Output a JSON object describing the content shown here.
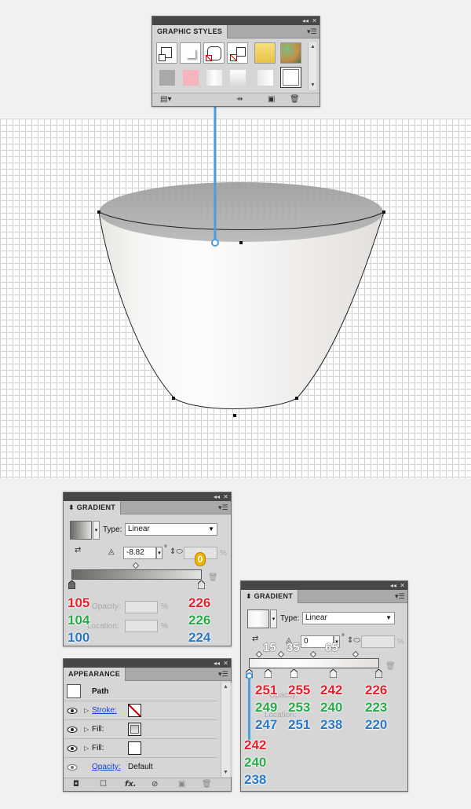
{
  "graphic_styles": {
    "title": "GRAPHIC STYLES"
  },
  "gradient_small": {
    "title": "GRADIENT",
    "type_label": "Type:",
    "type_value": "Linear",
    "angle_value": "-8.82",
    "degree_symbol": "°",
    "percent_symbol": "%",
    "opacity_label": "Opacity:",
    "location_label": "Location:",
    "badge_value": "0",
    "left_stop_rgb": [
      "105",
      "104",
      "100"
    ],
    "right_stop_rgb": [
      "226",
      "226",
      "224"
    ]
  },
  "gradient_large": {
    "title": "GRADIENT",
    "type_label": "Type:",
    "type_value": "Linear",
    "angle_value": "0",
    "degree_symbol": "°",
    "percent_symbol": "%",
    "opacity_label": "Opacity:",
    "location_label": "Location:",
    "midpoint_labels": [
      "15",
      "35",
      "65"
    ],
    "stops": [
      {
        "r": "251",
        "g": "249",
        "b": "247"
      },
      {
        "r": "255",
        "g": "253",
        "b": "251"
      },
      {
        "r": "242",
        "g": "240",
        "b": "238"
      },
      {
        "r": "226",
        "g": "223",
        "b": "220"
      }
    ],
    "first_stop_rgb": [
      "242",
      "240",
      "238"
    ]
  },
  "appearance": {
    "title": "APPEARANCE",
    "path_label": "Path",
    "stroke_label": "Stroke:",
    "fill_label_1": "Fill:",
    "fill_label_2": "Fill:",
    "opacity_label": "Opacity:",
    "opacity_value": "Default",
    "fx_label": "fx."
  },
  "colors": {
    "accent_line": "#4a9ee0",
    "cup_fill": "#f6f4f2",
    "cup_top": "#a6a6a6",
    "red": "#e3202b",
    "green": "#2aa84a",
    "blue": "#2a78c4",
    "badge": "#f0b400"
  }
}
